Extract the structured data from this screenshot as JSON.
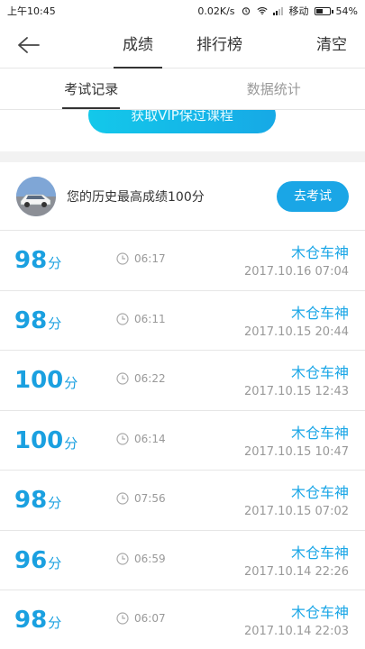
{
  "status": {
    "time": "上午10:45",
    "speed": "0.02K/s",
    "carrier": "移动",
    "battery": "54%",
    "battery_level": 0.54
  },
  "nav": {
    "tabs": [
      "成绩",
      "排行榜"
    ],
    "clear": "清空"
  },
  "subtabs": [
    "考试记录",
    "数据统计"
  ],
  "vip": {
    "label": "获取VIP保过课程"
  },
  "best": {
    "text": "您的历史最高成绩100分",
    "exam_button": "去考试"
  },
  "records": [
    {
      "score": "98",
      "unit": "分",
      "duration": "06:17",
      "name": "木仓车神",
      "date": "2017.10.16  07:04"
    },
    {
      "score": "98",
      "unit": "分",
      "duration": "06:11",
      "name": "木仓车神",
      "date": "2017.10.15  20:44"
    },
    {
      "score": "100",
      "unit": "分",
      "duration": "06:22",
      "name": "木仓车神",
      "date": "2017.10.15  12:43"
    },
    {
      "score": "100",
      "unit": "分",
      "duration": "06:14",
      "name": "木仓车神",
      "date": "2017.10.15  10:47"
    },
    {
      "score": "98",
      "unit": "分",
      "duration": "07:56",
      "name": "木仓车神",
      "date": "2017.10.15  07:02"
    },
    {
      "score": "96",
      "unit": "分",
      "duration": "06:59",
      "name": "木仓车神",
      "date": "2017.10.14  22:26"
    },
    {
      "score": "98",
      "unit": "分",
      "duration": "06:07",
      "name": "木仓车神",
      "date": "2017.10.14  22:03"
    }
  ],
  "colors": {
    "accent": "#1aa6e6",
    "score": "#1aa0e0",
    "muted": "#999999"
  }
}
